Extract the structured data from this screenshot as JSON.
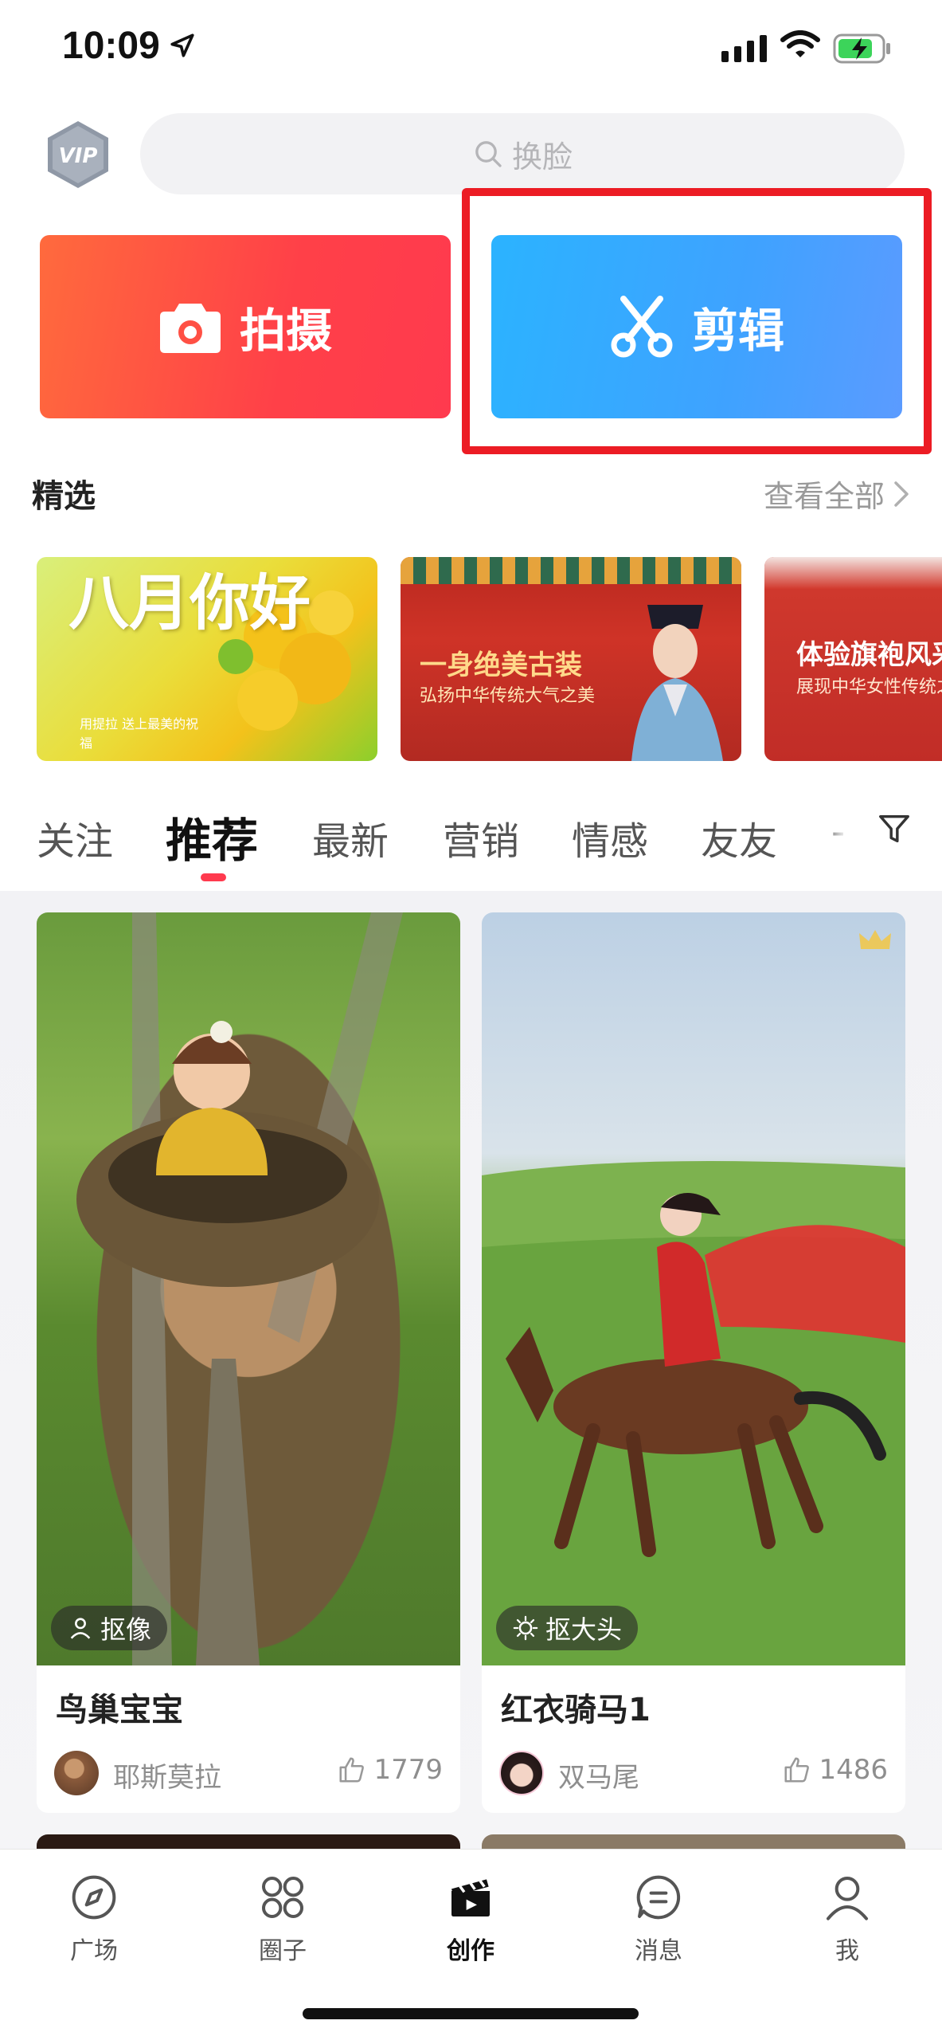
{
  "status_bar": {
    "time": "10:09"
  },
  "header": {
    "vip_label": "VIP",
    "search_placeholder": "换脸"
  },
  "actions": {
    "shoot_label": "拍摄",
    "edit_label": "剪辑"
  },
  "featured": {
    "title": "精选",
    "view_all": "查看全部",
    "banners": [
      {
        "title": "八月你好",
        "subtitle": "用提拉 送上最美的祝福"
      },
      {
        "title": "一身绝美古装",
        "subtitle": "弘扬中华传统大气之美"
      },
      {
        "title": "体验旗袍风采",
        "subtitle": "展现中华女性传统之美"
      }
    ]
  },
  "tabs": [
    "关注",
    "推荐",
    "最新",
    "营销",
    "情感",
    "友友",
    "-"
  ],
  "active_tab": "推荐",
  "feed": [
    {
      "tag": "抠像",
      "title": "鸟巢宝宝",
      "author": "耶斯莫拉",
      "likes": "1779"
    },
    {
      "tag": "抠大头",
      "title": "红衣骑马1",
      "author": "双马尾",
      "likes": "1486"
    }
  ],
  "bottom_nav": [
    {
      "label": "广场",
      "icon": "compass-icon"
    },
    {
      "label": "圈子",
      "icon": "grid-circles-icon"
    },
    {
      "label": "创作",
      "icon": "clapperboard-icon"
    },
    {
      "label": "消息",
      "icon": "chat-bubble-icon"
    },
    {
      "label": "我",
      "icon": "person-icon"
    }
  ],
  "colors": {
    "accent_red": "#ff3a4e",
    "accent_blue": "#3fa2ff",
    "highlight_box": "#ec1c24"
  }
}
